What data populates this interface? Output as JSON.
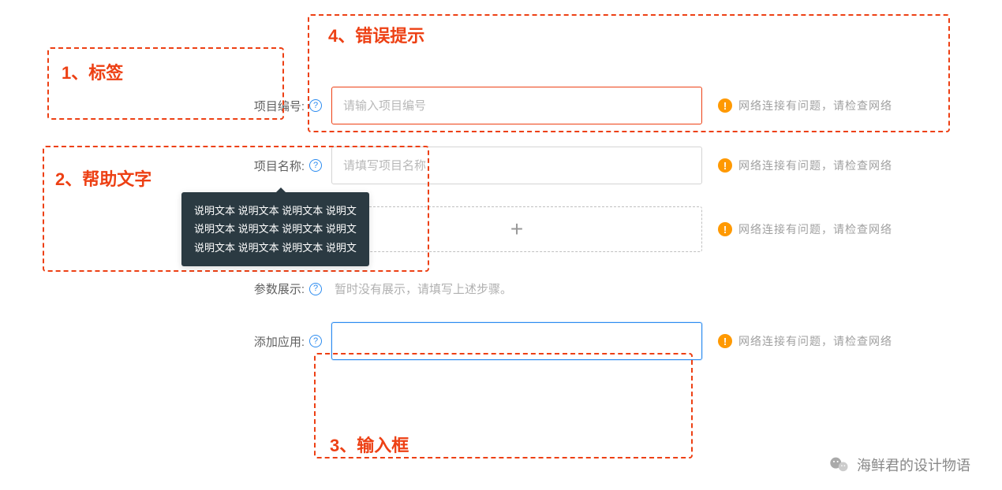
{
  "annotations": {
    "label": {
      "num": "1、",
      "text": "标签"
    },
    "help": {
      "num": "2、",
      "text": "帮助文字"
    },
    "input": {
      "num": "3、",
      "text": "输入框"
    },
    "error": {
      "num": "4、",
      "text": "错误提示"
    }
  },
  "form": {
    "row1": {
      "label": "项目编号:",
      "placeholder": "请输入项目编号",
      "error": "网络连接有问题，请检查网络"
    },
    "row2": {
      "label": "项目名称:",
      "placeholder": "请填写项目名称",
      "error": "网络连接有问题，请检查网络"
    },
    "row3": {
      "add_symbol": "+",
      "error": "网络连接有问题，请检查网络"
    },
    "row4": {
      "label": "参数展示:",
      "text": "暂时没有展示，请填写上述步骤。"
    },
    "row5": {
      "label": "添加应用:",
      "value": "",
      "error": "网络连接有问题，请检查网络"
    }
  },
  "tooltip": {
    "line1": "说明文本 说明文本 说明文本 说明文",
    "line2": "说明文本 说明文本 说明文本 说明文",
    "line3": "说明文本 说明文本 说明文本 说明文"
  },
  "icons": {
    "help": "?",
    "warn": "!"
  },
  "watermark": "海鲜君的设计物语"
}
